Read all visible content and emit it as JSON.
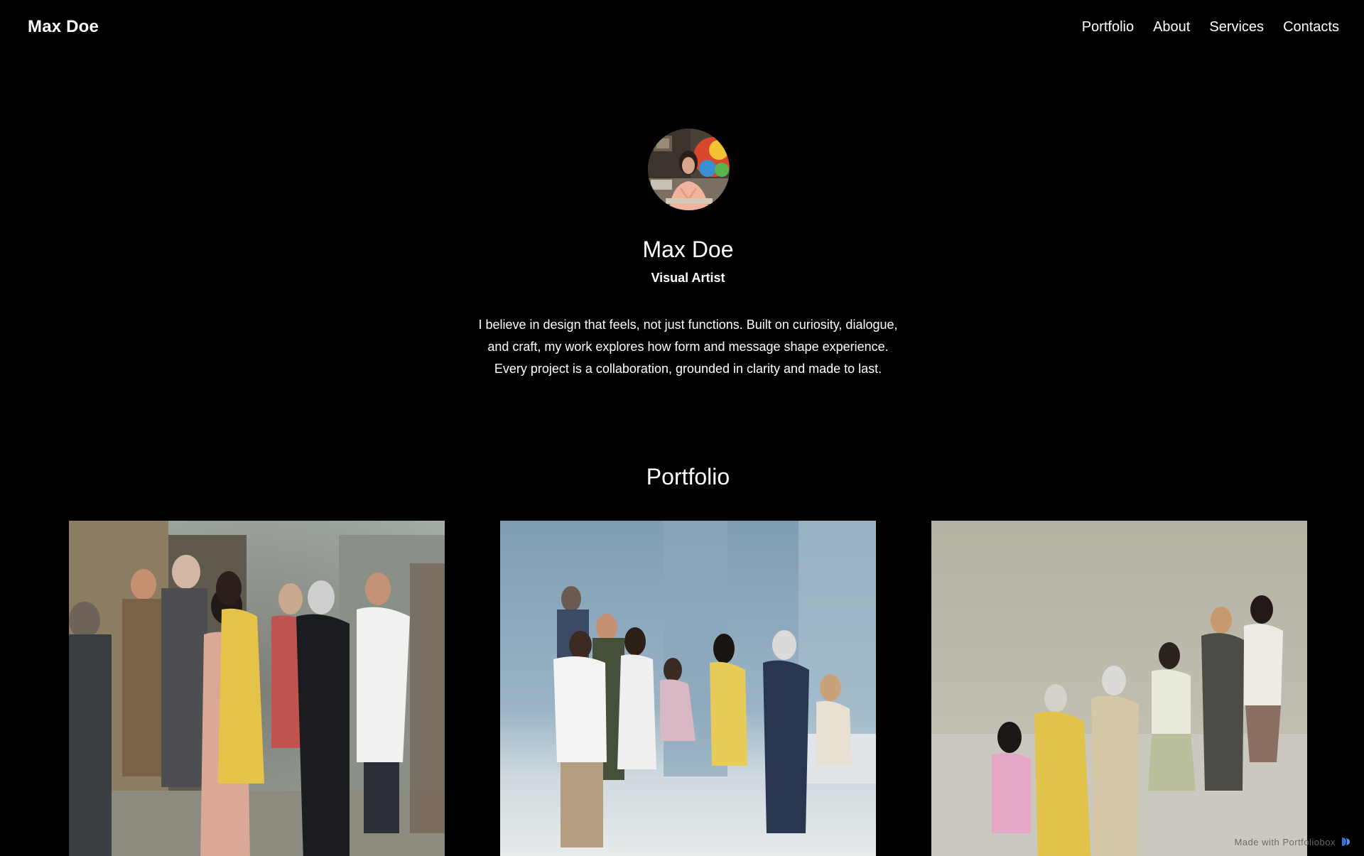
{
  "site": {
    "logo": "Max Doe"
  },
  "nav": {
    "items": [
      {
        "label": "Portfolio"
      },
      {
        "label": "About"
      },
      {
        "label": "Services"
      },
      {
        "label": "Contacts"
      }
    ]
  },
  "profile": {
    "name": "Max Doe",
    "role": "Visual Artist",
    "bio_lines": [
      "I believe in design that feels, not just functions. Built on curiosity, dialogue,",
      "and craft, my work explores how form and message shape experience.",
      "Every project is a collaboration, grounded in clarity and made to last."
    ]
  },
  "portfolio": {
    "title": "Portfolio"
  },
  "footer": {
    "badge_text": "Made with Portfoliobox"
  },
  "colors": {
    "background": "#000000",
    "text": "#ffffff",
    "badge_text": "#6b6b6b",
    "badge_icon": "#2f6fd6"
  }
}
